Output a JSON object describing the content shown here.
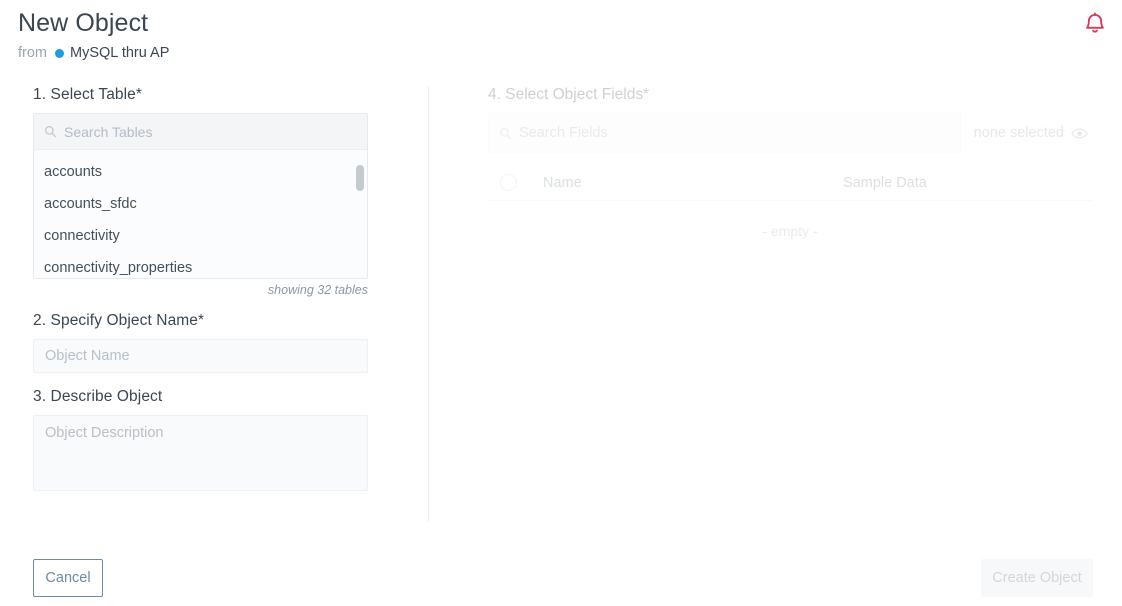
{
  "header": {
    "title": "New Object",
    "from_word": "from",
    "source_name": "MySQL thru AP",
    "source_dot_color": "#1b9fe0",
    "bell_icon": "bell-icon",
    "bell_color": "#d93a56"
  },
  "left": {
    "step1_label": "1. Select Table*",
    "search_tables_placeholder": "Search Tables",
    "search_icon": "search-icon",
    "tables": [
      "accounts",
      "accounts_sfdc",
      "connectivity",
      "connectivity_properties"
    ],
    "showing_count": "showing 32 tables",
    "step2_label": "2. Specify Object Name*",
    "object_name_placeholder": "Object Name",
    "object_name_value": "",
    "step3_label": "3. Describe Object",
    "object_description_placeholder": "Object Description",
    "object_description_value": ""
  },
  "right": {
    "step4_label": "4. Select Object Fields*",
    "search_fields_placeholder": "Search Fields",
    "search_icon": "search-icon",
    "selected_state": "none selected",
    "eye_icon": "eye-icon",
    "columns": {
      "name": "Name",
      "sample_data": "Sample Data"
    },
    "empty_text": "- empty -"
  },
  "footer": {
    "cancel_label": "Cancel",
    "create_label": "Create Object"
  }
}
